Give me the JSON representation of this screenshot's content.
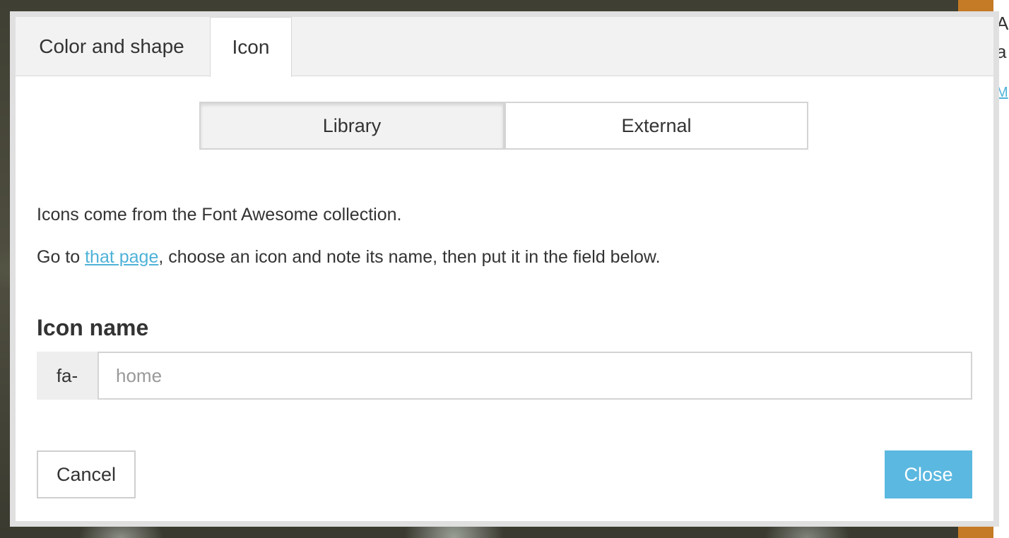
{
  "tabs": [
    {
      "label": "Color and shape",
      "active": false
    },
    {
      "label": "Icon",
      "active": true
    }
  ],
  "source_toggle": {
    "options": [
      "Library",
      "External"
    ],
    "selected": "Library"
  },
  "info": {
    "line1": "Icons come from the Font Awesome collection.",
    "line2_prefix": "Go to ",
    "line2_link": "that page",
    "line2_suffix": ", choose an icon and note its name, then put it in the field below."
  },
  "icon_field": {
    "label": "Icon name",
    "prefix": "fa-",
    "value": "",
    "placeholder": "home"
  },
  "buttons": {
    "cancel": "Cancel",
    "close": "Close"
  },
  "colors": {
    "accent": "#5bb8e0",
    "link": "#4eb2d8",
    "sidebar": "#c57a25"
  }
}
